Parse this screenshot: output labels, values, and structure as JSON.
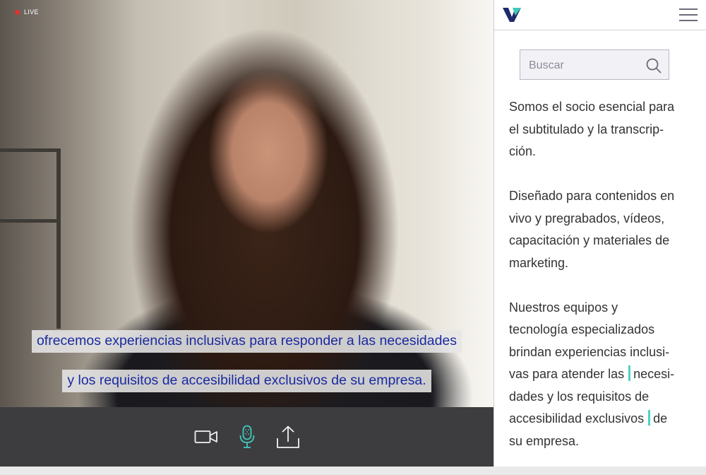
{
  "video": {
    "live_label": "LIVE",
    "captions": [
      "ofrecemos experiencias inclusivas para responder a las necesidades",
      "y los requisitos de accesibilidad exclusivos de su empresa."
    ],
    "toolbar": {
      "camera_icon": "video-camera-icon",
      "mic_icon": "microphone-icon",
      "share_icon": "upload-share-icon",
      "mic_active_color": "#3fc9bd"
    }
  },
  "sidebar": {
    "logo_icon": "brand-v-logo",
    "menu_icon": "hamburger-menu-icon",
    "search": {
      "placeholder": "Buscar",
      "value": ""
    },
    "paragraph1": [
      "Somos el socio esencial para",
      "el subtitulado y la transcrip-",
      "ción."
    ],
    "paragraph2": [
      "Diseñado para contenidos en",
      "vivo y pregrabados, vídeos,",
      "capacitación y materiales de",
      "marketing."
    ],
    "paragraph3": {
      "line1": "Nuestros equipos y",
      "line2": "tecnología especializados",
      "line3": "brindan experiencias inclusi-",
      "line4a": "vas para atender las",
      "line4b": "necesi-",
      "line5": "dades y los requisitos de",
      "line6a": "accesibilidad exclusivos",
      "line6b": "de",
      "line7": "su empresa."
    },
    "highlight_color": "#4fd1c5"
  }
}
